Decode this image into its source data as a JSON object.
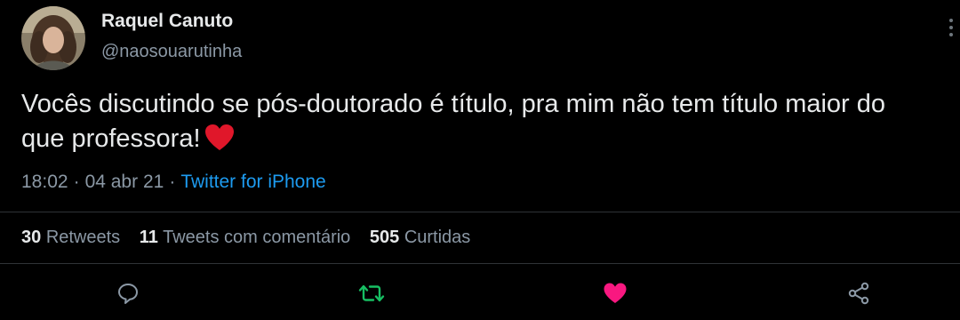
{
  "author": {
    "name": "Raquel Canuto",
    "handle": "@naosouarutinha",
    "avatar_icon": "profile-photo"
  },
  "tweet": {
    "text": "Vocês discutindo se pós-doutorado é título, pra mim não tem título maior do que professora!",
    "emoji": "red-heart"
  },
  "meta": {
    "time": "18:02",
    "date": "04 abr 21",
    "separator": "·",
    "source": "Twitter for iPhone"
  },
  "stats": {
    "retweets_count": "30",
    "retweets_label": "Retweets",
    "comments_count": "11",
    "comments_label": "Tweets com comentário",
    "likes_count": "505",
    "likes_label": "Curtidas"
  },
  "actions": [
    {
      "name": "reply",
      "icon": "speech-bubble-icon"
    },
    {
      "name": "retweet",
      "icon": "retweet-icon",
      "color": "#17bf63",
      "active": true
    },
    {
      "name": "like",
      "icon": "heart-icon",
      "color": "#f91880",
      "active": true
    },
    {
      "name": "share",
      "icon": "share-icon"
    }
  ],
  "colors": {
    "background": "#000000",
    "text": "#e7e9ea",
    "muted": "#8b98a5",
    "link": "#1d9bf0",
    "divider": "#2f3336"
  }
}
